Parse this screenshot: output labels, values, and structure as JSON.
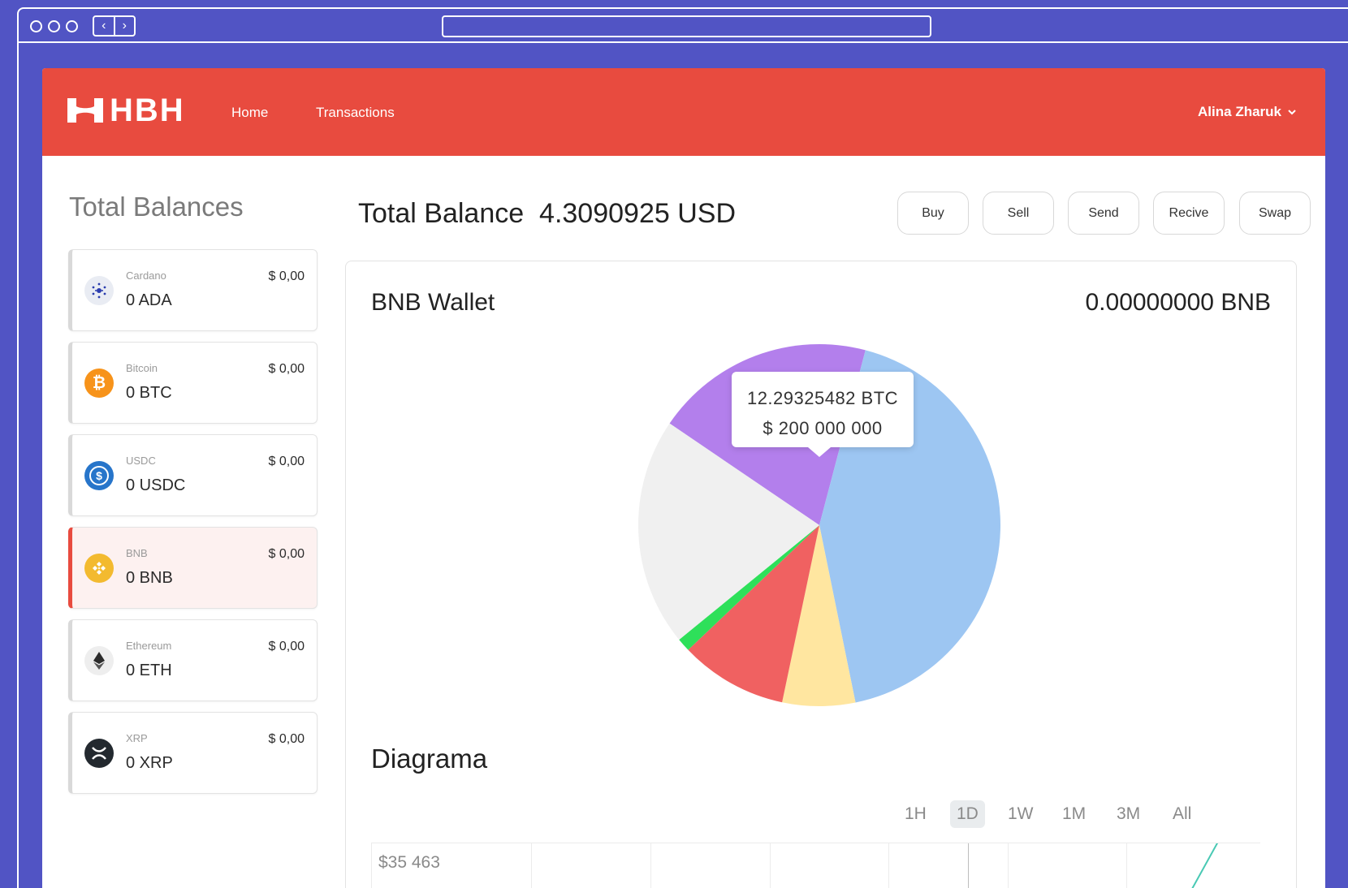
{
  "header": {
    "brand": "HBH",
    "nav": [
      "Home",
      "Transactions"
    ],
    "user": "Alina Zharuk"
  },
  "sidebar": {
    "title": "Total Balances",
    "coins": [
      {
        "name": "Cardano",
        "amount": "0 ADA",
        "usd": "$ 0,00",
        "icon": "cardano-icon",
        "color": "#e9ecf3"
      },
      {
        "name": "Bitcoin",
        "amount": "0 BTC",
        "usd": "$ 0,00",
        "icon": "bitcoin-icon",
        "color": "#f7931a"
      },
      {
        "name": "USDC",
        "amount": "0 USDC",
        "usd": "$ 0,00",
        "icon": "usdc-icon",
        "color": "#2775ca"
      },
      {
        "name": "BNB",
        "amount": "0 BNB",
        "usd": "$ 0,00",
        "icon": "bnb-icon",
        "color": "#f3ba2f"
      },
      {
        "name": "Ethereum",
        "amount": "0 ETH",
        "usd": "$ 0,00",
        "icon": "ethereum-icon",
        "color": "#eeeeee"
      },
      {
        "name": "XRP",
        "amount": "0 XRP",
        "usd": "$ 0,00",
        "icon": "xrp-icon",
        "color": "#23292f"
      }
    ],
    "active_index": 3
  },
  "main": {
    "total_label": "Total Balance",
    "total_value": "4.3090925 USD",
    "actions": [
      "Buy",
      "Sell",
      "Send",
      "Recive",
      "Swap"
    ]
  },
  "wallet": {
    "title": "BNB Wallet",
    "amount": "0.00000000 BNB",
    "tooltip": {
      "line1": "12.29325482 BTC",
      "line2": "$ 200 000 000"
    }
  },
  "chart_data": {
    "type": "pie",
    "slices": [
      {
        "name": "",
        "value": 19.6,
        "color": "#b37fec"
      },
      {
        "name": "",
        "value": 42.7,
        "color": "#9dc6f2"
      },
      {
        "name": "",
        "value": 6.5,
        "color": "#ffe6a0"
      },
      {
        "name": "",
        "value": 9.6,
        "color": "#f06161"
      },
      {
        "name": "",
        "value": 1.2,
        "color": "#2ee05a"
      },
      {
        "name": "",
        "value": 20.4,
        "color": "#f0f0f0"
      }
    ]
  },
  "diagram": {
    "title": "Diagrama",
    "ranges": [
      "1H",
      "1D",
      "1W",
      "1M",
      "3M",
      "All"
    ],
    "active_range": "1D",
    "price_label": "$35 463"
  }
}
